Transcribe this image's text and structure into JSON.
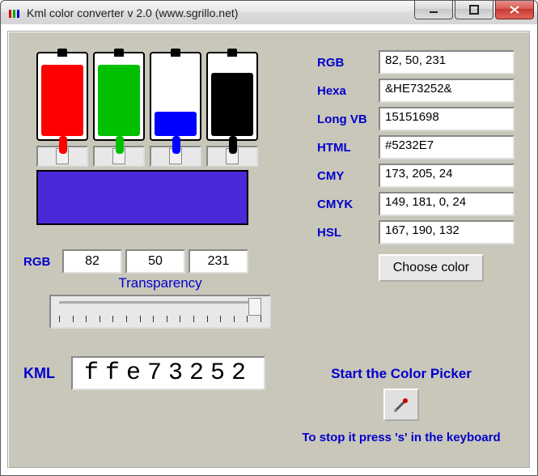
{
  "window": {
    "title": "Kml color converter v 2.0 (www.sgrillo.net)"
  },
  "fields": {
    "rgb": {
      "label": "RGB",
      "value": "82, 50, 231"
    },
    "hexa": {
      "label": "Hexa",
      "value": "&HE73252&"
    },
    "longvb": {
      "label": "Long VB",
      "value": "15151698"
    },
    "html": {
      "label": "HTML",
      "value": "#5232E7"
    },
    "cmy": {
      "label": "CMY",
      "value": "173, 205, 24"
    },
    "cmyk": {
      "label": "CMYK",
      "value": "149, 181, 0, 24"
    },
    "hsl": {
      "label": "HSL",
      "value": "167, 190, 132"
    }
  },
  "choose_label": "Choose color",
  "rgb_inputs": {
    "label": "RGB",
    "r": "82",
    "g": "50",
    "b": "231"
  },
  "transparency_label": "Transparency",
  "kml": {
    "label": "KML",
    "value": "ffe73252"
  },
  "colors": {
    "red": "#ff0000",
    "green": "#00c000",
    "blue": "#0000ff",
    "black": "#000000",
    "mix": "#4a29d9"
  },
  "fill_heights": {
    "red": "88",
    "green": "88",
    "blue": "30",
    "black": "78"
  },
  "picker": {
    "start": "Start the Color Picker",
    "stop": "To stop it press 's' in the keyboard"
  }
}
